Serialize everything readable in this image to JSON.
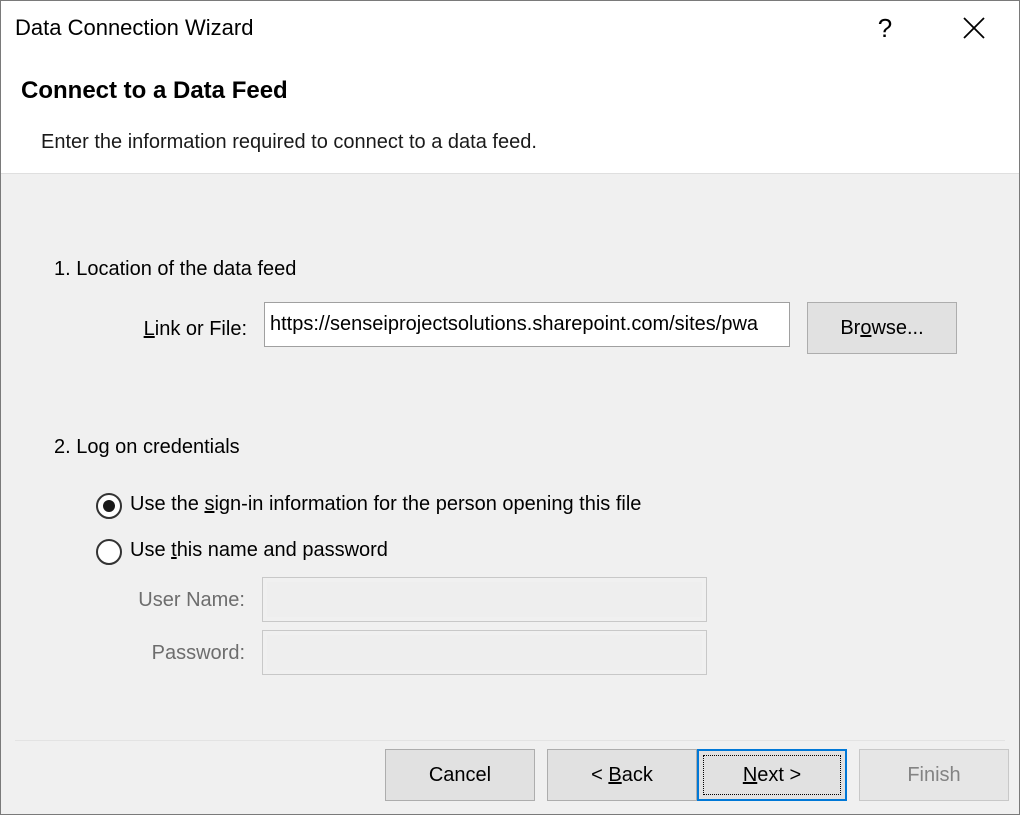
{
  "window": {
    "title": "Data Connection Wizard",
    "help_label": "?"
  },
  "header": {
    "title": "Connect to a Data Feed",
    "subtitle": "Enter the information required to connect to a data feed."
  },
  "location": {
    "section_label": "1. Location of the data feed",
    "link_label_underlined": "L",
    "link_label_rest": "ink or File:",
    "link_value": "https://senseiprojectsolutions.sharepoint.com/sites/pwa",
    "browse_pre": "Br",
    "browse_underlined": "o",
    "browse_post": "wse..."
  },
  "credentials": {
    "section_label": "2. Log on credentials",
    "option1_pre": "Use the ",
    "option1_underlined": "s",
    "option1_post": "ign-in information for the person opening this file",
    "option1_checked": true,
    "option2_pre": "Use ",
    "option2_underlined": "t",
    "option2_post": "his name and password",
    "option2_checked": false,
    "username_label": "User Name:",
    "username_value": "",
    "password_label": "Password:",
    "password_value": ""
  },
  "footer": {
    "cancel_label": "Cancel",
    "back_pre": "< ",
    "back_underlined": "B",
    "back_post": "ack",
    "next_underlined": "N",
    "next_post": "ext >",
    "finish_label": "Finish"
  },
  "icons": {
    "close": "close-icon"
  },
  "colors": {
    "accent": "#0078d7",
    "dialog_bg": "#f0f0f0",
    "header_bg": "#ffffff"
  }
}
